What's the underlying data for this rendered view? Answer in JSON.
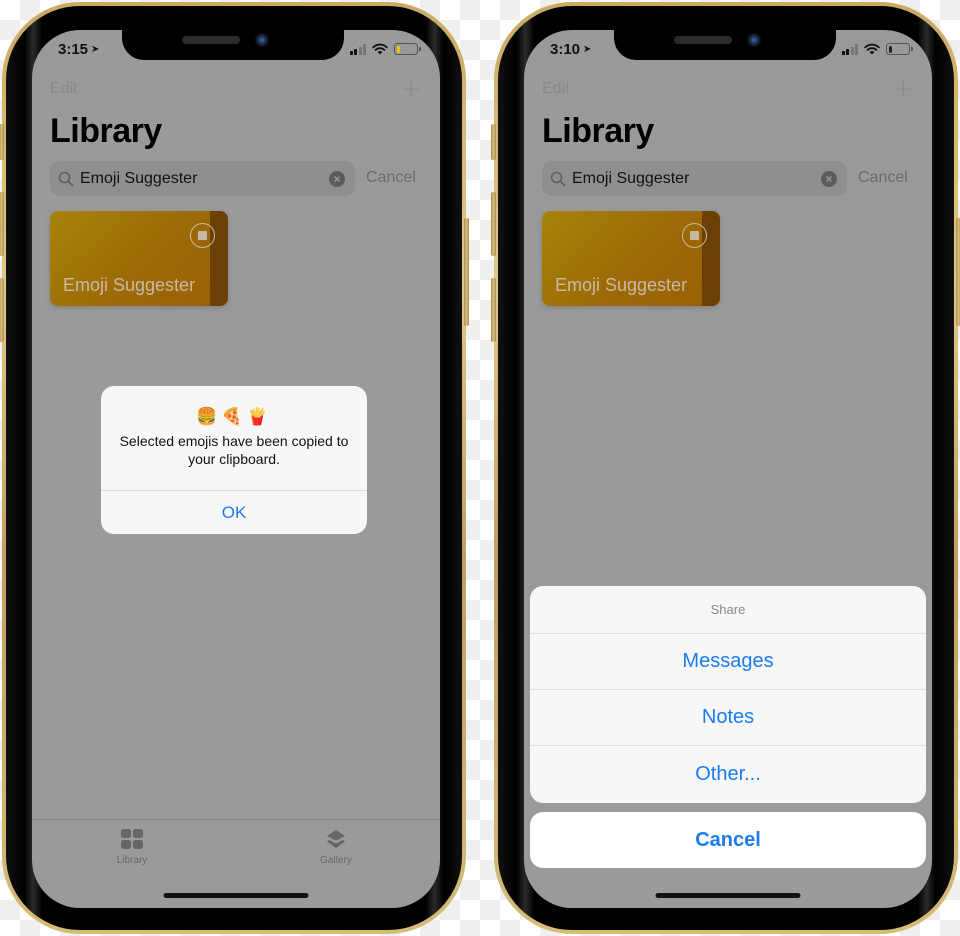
{
  "phones": [
    {
      "status": {
        "time": "3:15",
        "location_icon": "location-arrow-icon",
        "signal_bars_on": 2,
        "signal_bars_total": 4,
        "wifi_icon": "wifi-icon",
        "battery_level": 0.2,
        "battery_color": "#f5c400"
      },
      "nav": {
        "edit_label": "Edit",
        "add_icon": "plus-icon"
      },
      "title": "Library",
      "search": {
        "value": "Emoji Suggester",
        "cancel_label": "Cancel"
      },
      "shortcut_card": {
        "label": "Emoji Suggester",
        "stop_icon": "stop-icon"
      },
      "alert": {
        "emojis": "🍔🍕🍟",
        "message": "Selected emojis have been copied to your clipboard.",
        "ok_label": "OK"
      },
      "tabbar": {
        "tabs": [
          {
            "label": "Library",
            "icon": "grid-icon"
          },
          {
            "label": "Gallery",
            "icon": "layers-icon"
          }
        ]
      }
    },
    {
      "status": {
        "time": "3:10",
        "location_icon": "location-arrow-icon",
        "signal_bars_on": 2,
        "signal_bars_total": 4,
        "wifi_icon": "wifi-icon",
        "battery_level": 0.2,
        "battery_color": "#222222"
      },
      "nav": {
        "edit_label": "Edit",
        "add_icon": "plus-icon"
      },
      "title": "Library",
      "search": {
        "value": "Emoji Suggester",
        "cancel_label": "Cancel"
      },
      "shortcut_card": {
        "label": "Emoji Suggester",
        "stop_icon": "stop-icon"
      },
      "action_sheet": {
        "title": "Share",
        "options": [
          "Messages",
          "Notes",
          "Other..."
        ],
        "cancel_label": "Cancel"
      }
    }
  ],
  "colors": {
    "accent": "#1a7cf0",
    "dimmed_background": "#9a9a9a",
    "card_gradient_start": "#a6830a",
    "card_gradient_end": "#9a5f06",
    "frame_gold": "#d6bb77"
  }
}
